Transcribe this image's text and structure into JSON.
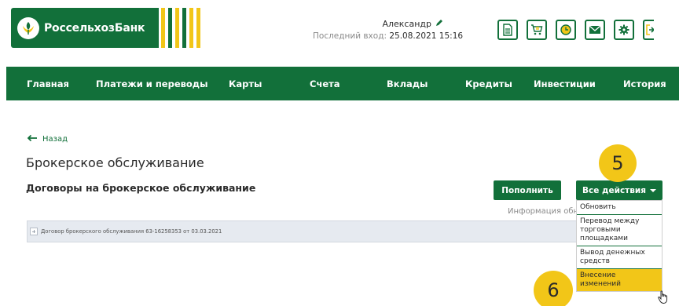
{
  "header": {
    "logo_text": "РоссельхозБанк",
    "user_name": "Александр",
    "last_login_label": "Последний вход:",
    "last_login_value": "25.08.2021 15:16"
  },
  "nav": {
    "items": [
      {
        "label": "Главная"
      },
      {
        "label": "Платежи и переводы"
      },
      {
        "label": "Карты"
      },
      {
        "label": "Счета"
      },
      {
        "label": "Вклады"
      },
      {
        "label": "Кредиты"
      },
      {
        "label": "Инвестиции"
      },
      {
        "label": "История"
      }
    ]
  },
  "content": {
    "back_label": "Назад",
    "page_title": "Брокерское обслуживание",
    "section_title": "Договоры на брокерское обслуживание",
    "topup_button": "Пополнить",
    "actions_button": "Все действия",
    "info_text": "Информация обно",
    "contract_row": "Договор брокерского обслуживания 63-16258353 от 03.03.2021"
  },
  "dropdown": {
    "items": [
      {
        "label": "Обновить"
      },
      {
        "label": "Перевод между торговыми площадками"
      },
      {
        "label": "Вывод денежных средств"
      },
      {
        "label": "Внесение изменений"
      }
    ]
  },
  "markers": {
    "step5": "5",
    "step6": "6"
  },
  "colors": {
    "brand_green": "#12703a",
    "brand_yellow": "#f2c618",
    "row_background": "#e6eaf0"
  },
  "icons": [
    "document-icon",
    "cart-icon",
    "clock-icon",
    "mail-icon",
    "gear-icon",
    "logout-icon",
    "pencil-icon",
    "arrow-left-icon",
    "hand-cursor-icon"
  ]
}
